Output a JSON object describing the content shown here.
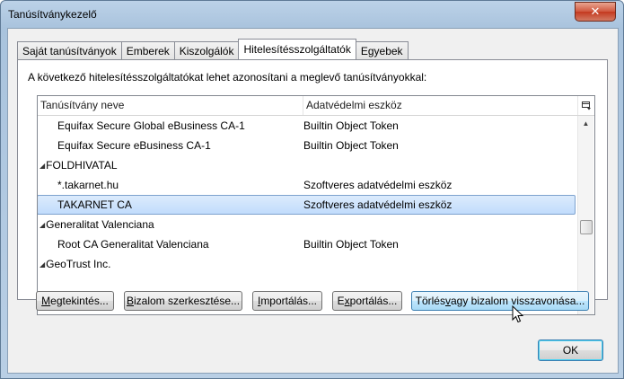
{
  "window": {
    "title": "Tanúsítványkezelő"
  },
  "tabs": [
    {
      "label": "Saját tanúsítványok",
      "active": false
    },
    {
      "label": "Emberek",
      "active": false
    },
    {
      "label": "Kiszolgálók",
      "active": false
    },
    {
      "label": "Hitelesítésszolgáltatók",
      "active": true
    },
    {
      "label": "Egyebek",
      "active": false
    }
  ],
  "panel": {
    "description": "A következő hitelesítésszolgáltatókat lehet azonosítani a meglevő tanúsítványokkal:"
  },
  "list": {
    "columns": {
      "name": "Tanúsítvány neve",
      "token": "Adatvédelmi eszköz"
    },
    "rows": [
      {
        "name": "Equifax Secure Global eBusiness CA-1",
        "token": "Builtin Object Token",
        "kind": "child",
        "selected": false
      },
      {
        "name": "Equifax Secure eBusiness CA-1",
        "token": "Builtin Object Token",
        "kind": "child",
        "selected": false
      },
      {
        "name": "FOLDHIVATAL",
        "token": "",
        "kind": "group",
        "selected": false
      },
      {
        "name": "*.takarnet.hu",
        "token": "Szoftveres adatvédelmi eszköz",
        "kind": "child",
        "selected": false
      },
      {
        "name": "TAKARNET CA",
        "token": "Szoftveres adatvédelmi eszköz",
        "kind": "child",
        "selected": true
      },
      {
        "name": "Generalitat Valenciana",
        "token": "",
        "kind": "group",
        "selected": false
      },
      {
        "name": "Root CA Generalitat Valenciana",
        "token": "Builtin Object Token",
        "kind": "child",
        "selected": false
      },
      {
        "name": "GeoTrust Inc.",
        "token": "",
        "kind": "group",
        "selected": false
      }
    ]
  },
  "buttons": {
    "view": {
      "pre": "",
      "accel": "M",
      "post": "egtekintés..."
    },
    "edit_trust": {
      "pre": "",
      "accel": "B",
      "post": "izalom szerkesztése..."
    },
    "import": {
      "pre": "",
      "accel": "I",
      "post": "mportálás..."
    },
    "export": {
      "pre": "E",
      "accel": "x",
      "post": "portálás..."
    },
    "delete": {
      "pre": "Törlés ",
      "accel": "v",
      "post": "agy bizalom visszavonása..."
    },
    "ok": "OK"
  },
  "colors": {
    "selection": "#c1dcfc",
    "titlebar": "#bcd2e8",
    "close": "#c4391f"
  },
  "icons": {
    "close": "close-icon",
    "column_picker": "column-picker-icon",
    "expander": "expander-icon",
    "cursor": "mouse-pointer-icon"
  }
}
